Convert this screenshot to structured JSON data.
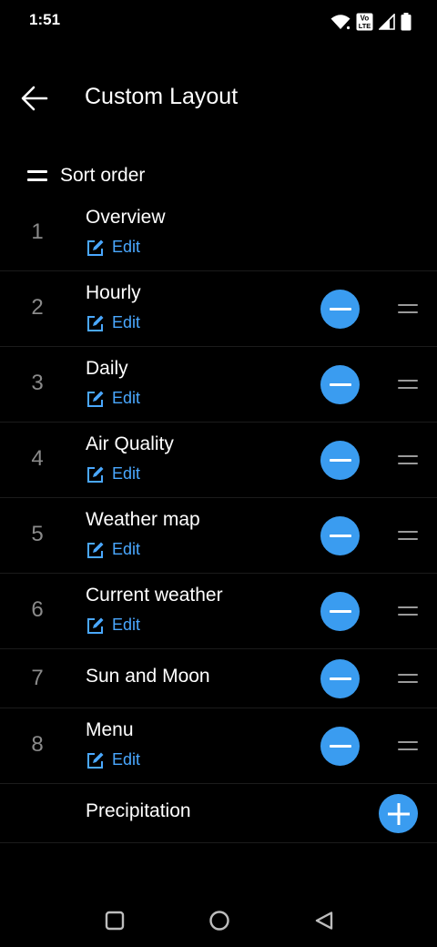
{
  "status_bar": {
    "time": "1:51",
    "icons": [
      "wifi-icon",
      "volte-icon",
      "signal-icon",
      "battery-icon"
    ],
    "volte_top": "Vo",
    "volte_bottom": "LTE"
  },
  "header": {
    "back_icon": "arrow-left-icon",
    "title": "Custom Layout"
  },
  "sort": {
    "icon": "sort-icon",
    "label": "Sort order"
  },
  "colors": {
    "background": "#000000",
    "accent": "#3a9cf0",
    "link": "#4aa8ff",
    "number": "#8a8a8a"
  },
  "items": [
    {
      "number": "1",
      "title": "Overview",
      "edit": "Edit"
    },
    {
      "number": "2",
      "title": "Hourly",
      "edit": "Edit"
    },
    {
      "number": "3",
      "title": "Daily",
      "edit": "Edit"
    },
    {
      "number": "4",
      "title": "Air Quality",
      "edit": "Edit"
    },
    {
      "number": "5",
      "title": "Weather map",
      "edit": "Edit"
    },
    {
      "number": "6",
      "title": "Current weather",
      "edit": "Edit"
    },
    {
      "number": "7",
      "title": "Sun and Moon"
    },
    {
      "number": "8",
      "title": "Menu",
      "edit": "Edit"
    }
  ],
  "available": [
    {
      "title": "Precipitation"
    }
  ],
  "nav_bar": {
    "icons": [
      "recents-square-icon",
      "home-circle-icon",
      "back-triangle-icon"
    ]
  }
}
